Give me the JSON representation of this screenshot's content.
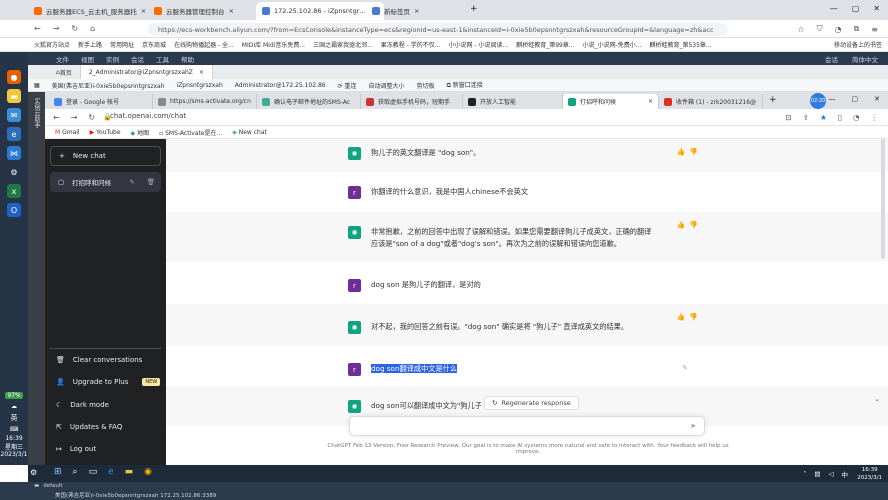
{
  "outer_browser": {
    "tabs": [
      {
        "label": "云服务器ECS_云主机_服务器托",
        "color": "#ff6a00"
      },
      {
        "label": "云服务器管理控制台",
        "color": "#ff6a00"
      },
      {
        "label": "172.25.102.86 - iZpnsntgrszxah",
        "color": "#4a7bd0"
      },
      {
        "label": "新标签页",
        "color": "#4a7bd0"
      }
    ],
    "url": "https://ecs-workbench.aliyun.com/?from=EcsConsole&instanceType=ecs&regionId=us-east-1&instanceId=i-0xie5b0epsnntgrszxah&resourceGroupId=&language=zh&acc",
    "bookmarks": [
      "火狐官方站点",
      "新手上路",
      "常用网址",
      "京东商城",
      "在线购物播起器 - 全...",
      "MIDI库 Midi音乐免费...",
      "三国之霸家我驱北邻...",
      "果冻教程 - 学的不仅...",
      "小小说网 - 小说阅读...",
      "麒桥蛙教育_第99章...",
      "小说_小说网-免费小...",
      "麒桥蛙教育_第535章...",
      "移动设备上的书签"
    ]
  },
  "workbench": {
    "menu": [
      "文件",
      "视图",
      "实例",
      "会话",
      "工具",
      "帮助"
    ],
    "menu_right": [
      "会话",
      "简体中文"
    ],
    "rdp_tabs": [
      "首页",
      "2_Administrator@iZpnsntgrszxahZ"
    ],
    "rdp_tools": [
      "美国(弗吉尼亚)i-0xie5b0epsnntgrszxah",
      "iZpnsntgrszxah",
      "Administrator@172.25.102.86",
      "重连",
      "自动调整大小",
      "剪切板",
      "新窗口连接"
    ],
    "side_label": "实例云助手"
  },
  "inner_browser": {
    "tabs": [
      {
        "label": "登录 - Google 帐号",
        "color": "#4285f4"
      },
      {
        "label": "https://sms-activate.org/cn",
        "color": "#888"
      },
      {
        "label": "确认电子邮件地址的SMS-Ac",
        "color": "#4a9"
      },
      {
        "label": "获取虚拟手机号码，短期手",
        "color": "#c33"
      },
      {
        "label": "开放人工智能",
        "color": "#222"
      },
      {
        "label": "打招呼和问候",
        "color": "#10a37f"
      },
      {
        "label": "收件箱 (1) - zrk20031216@",
        "color": "#d93025"
      }
    ],
    "url": "chat.openai.com/chat",
    "bookmarks": [
      "Gmail",
      "YouTube",
      "地图",
      "SMS-Activate是在...",
      "New chat"
    ]
  },
  "chat": {
    "sidebar": {
      "new_chat": "New chat",
      "conversation": "打招呼和问候",
      "bottom": [
        "Clear conversations",
        "Upgrade to Plus",
        "Dark mode",
        "Updates & FAQ",
        "Log out"
      ],
      "new_badge": "NEW"
    },
    "messages": [
      {
        "role": "assistant",
        "text": "狗儿子的英文翻译是 \"dog son\"。"
      },
      {
        "role": "user",
        "text": "你翻译的什么意识，我是中国人chinese不会英文"
      },
      {
        "role": "assistant",
        "text": "非常抱歉，之前的回答中出现了误解和错误。如果您需要翻译狗儿子成英文，正确的翻译应该是\"son of a dog\"或者\"dog's son\"。再次为之前的误解和错误向您道歉。"
      },
      {
        "role": "user",
        "text": "dog son 是狗儿子的翻译，是对的"
      },
      {
        "role": "assistant",
        "text": "对不起，我的回答之前有误。\"dog son\" 确实是将 \"狗儿子\" 直译成英文的结果。"
      },
      {
        "role": "user",
        "text": "dog son翻译成中文是什么",
        "selected": "dog son翻译成中文是什么"
      },
      {
        "role": "assistant",
        "text": "dog son可以翻译成中文为\"狗儿子"
      }
    ],
    "user_avatar": "r",
    "regenerate": "Regenerate response",
    "footer": "ChatGPT Feb 13 Version. Free Research Preview. Our goal is to make AI systems more natural and safe to interact with. Your feedback will help us improve."
  },
  "system": {
    "battery": "97%",
    "lang": "英",
    "time": "16:39",
    "weekday": "星期三",
    "date": "2023/3/1",
    "taskbar_time": "16:39",
    "taskbar_date": "2023/3/1",
    "status_left": "default",
    "status_host": "美国(弗吉尼亚)i-0xie5b0epsnntgrszxah 172.25.102.86:3389",
    "taskbar_ime": "中",
    "avatar_time": "02:20"
  }
}
